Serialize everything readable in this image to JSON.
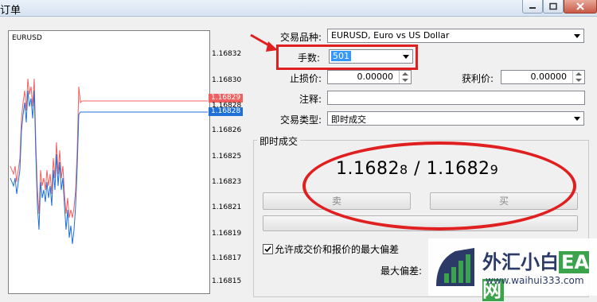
{
  "window": {
    "title": "订单"
  },
  "chart": {
    "symbol": "EURUSD",
    "ticks": [
      "1.16832",
      "1.16830",
      "1.16828",
      "1.16826",
      "1.16825",
      "1.16823",
      "1.16821",
      "1.16819",
      "1.16817",
      "1.16815"
    ],
    "ask_tag": "1.16829",
    "bid_tag": "1.16828",
    "mid_label": "1.16828",
    "ask_color": "#f06060",
    "bid_color": "#1f6fd8"
  },
  "form": {
    "symbol_label": "交易品种:",
    "symbol_value": "EURUSD, Euro vs US Dollar",
    "volume_label": "手数:",
    "volume_value": "501",
    "sl_label": "止损价:",
    "sl_value": "0.00000",
    "tp_label": "获利价:",
    "tp_value": "0.00000",
    "comment_label": "注释:",
    "comment_value": "",
    "type_label": "交易类型:",
    "type_value": "即时成交"
  },
  "execution": {
    "group_title": "即时成交",
    "bid_main": "1.1682",
    "bid_last": "8",
    "separator": " / ",
    "ask_main": "1.1682",
    "ask_last": "9",
    "sell_label": "卖",
    "buy_label": "买",
    "deviation_check_label": "允许成交价和报价的最大偏差",
    "max_deviation_label": "最大偏差:"
  },
  "watermark": {
    "name_a": "外汇小白",
    "name_b": "EA网",
    "url": "www.waihui333.com"
  }
}
